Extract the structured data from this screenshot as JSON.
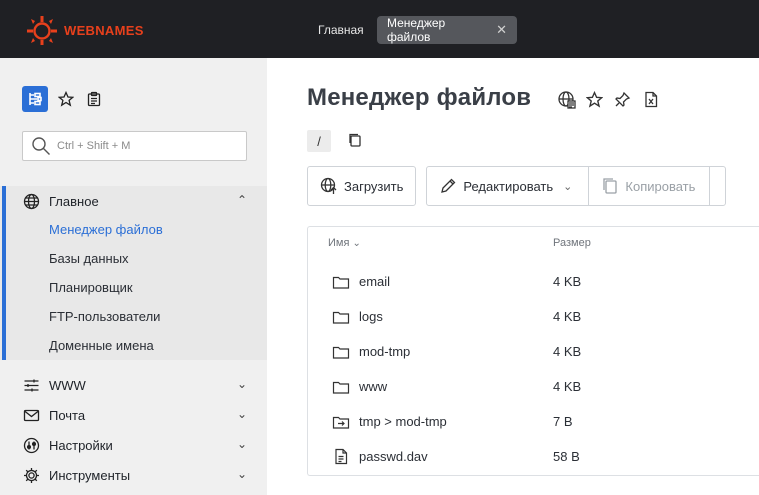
{
  "brand": {
    "name": "WEBNAMES",
    "color": "#e8401c"
  },
  "tabs": [
    {
      "label": "Главная"
    },
    {
      "label": "Менеджер файлов",
      "close_icon": "close-icon"
    }
  ],
  "sidebar": {
    "search_placeholder": "Ctrl + Shift + M",
    "groups": [
      {
        "label": "Главное",
        "icon": "globe-icon",
        "expanded": true,
        "items": [
          "Менеджер файлов",
          "Базы данных",
          "Планировщик",
          "FTP-пользователи",
          "Доменные имена"
        ],
        "active_item": "Менеджер файлов"
      },
      {
        "label": "WWW",
        "icon": "sliders-icon",
        "expanded": false
      },
      {
        "label": "Почта",
        "icon": "mail-icon",
        "expanded": false
      },
      {
        "label": "Настройки",
        "icon": "settings-icon",
        "expanded": false
      },
      {
        "label": "Инструменты",
        "icon": "gear-icon",
        "expanded": false
      }
    ]
  },
  "main": {
    "title": "Менеджер файлов",
    "path": "/",
    "toolbar": {
      "upload": "Загрузить",
      "edit": "Редактировать",
      "copy": "Копировать"
    },
    "table": {
      "columns": {
        "name": "Имя",
        "size": "Размер"
      },
      "rows": [
        {
          "name": "email",
          "size": "4 KB",
          "icon": "folder-icon"
        },
        {
          "name": "logs",
          "size": "4 KB",
          "icon": "folder-icon"
        },
        {
          "name": "mod-tmp",
          "size": "4 KB",
          "icon": "folder-icon"
        },
        {
          "name": "www",
          "size": "4 KB",
          "icon": "folder-icon"
        },
        {
          "name": "tmp > mod-tmp",
          "size": "7 B",
          "icon": "folder-link-icon"
        },
        {
          "name": "passwd.dav",
          "size": "58 B",
          "icon": "file-icon"
        }
      ]
    }
  },
  "colors": {
    "accent": "#2b6fd6",
    "topbar": "#1f2024",
    "sidebar": "#f0f0f0"
  }
}
